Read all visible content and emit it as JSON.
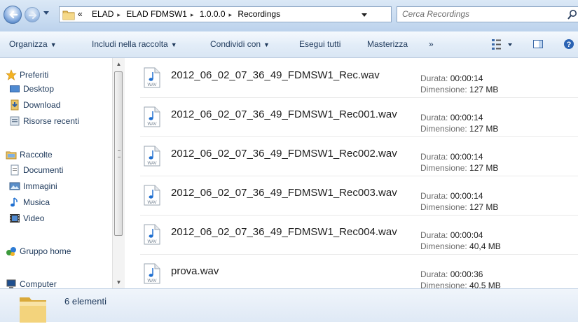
{
  "address": {
    "crumbs": [
      "«",
      "ELAD",
      "ELAD FDMSW1",
      "1.0.0.0",
      "Recordings"
    ],
    "search_placeholder": "Cerca Recordings"
  },
  "toolbar": {
    "organize": "Organizza",
    "include": "Includi nella raccolta",
    "share": "Condividi con",
    "play_all": "Esegui tutti",
    "burn": "Masterizza",
    "more": "»"
  },
  "nav": {
    "favorites": "Preferiti",
    "desktop": "Desktop",
    "download": "Download",
    "recent": "Risorse recenti",
    "libraries": "Raccolte",
    "documents": "Documenti",
    "pictures": "Immagini",
    "music": "Musica",
    "video": "Video",
    "homegroup": "Gruppo home",
    "computer": "Computer"
  },
  "files": [
    {
      "name": "2012_06_02_07_36_49_FDMSW1_Rec.wav",
      "duration_label": "Durata:",
      "duration": "00:00:14",
      "size_label": "Dimensione:",
      "size": "127 MB"
    },
    {
      "name": "2012_06_02_07_36_49_FDMSW1_Rec001.wav",
      "duration_label": "Durata:",
      "duration": "00:00:14",
      "size_label": "Dimensione:",
      "size": "127 MB"
    },
    {
      "name": "2012_06_02_07_36_49_FDMSW1_Rec002.wav",
      "duration_label": "Durata:",
      "duration": "00:00:14",
      "size_label": "Dimensione:",
      "size": "127 MB"
    },
    {
      "name": "2012_06_02_07_36_49_FDMSW1_Rec003.wav",
      "duration_label": "Durata:",
      "duration": "00:00:14",
      "size_label": "Dimensione:",
      "size": "127 MB"
    },
    {
      "name": "2012_06_02_07_36_49_FDMSW1_Rec004.wav",
      "duration_label": "Durata:",
      "duration": "00:00:04",
      "size_label": "Dimensione:",
      "size": "40,4 MB"
    },
    {
      "name": "prova.wav",
      "duration_label": "Durata:",
      "duration": "00:00:36",
      "size_label": "Dimensione:",
      "size": "40,5 MB"
    }
  ],
  "file_icon_label": "WAV",
  "status": {
    "count": "6 elementi"
  },
  "icons": {
    "back": "back-arrow-icon",
    "forward": "forward-arrow-icon",
    "refresh": "refresh-icon",
    "search": "search-icon",
    "view": "view-options-icon",
    "preview_pane": "preview-pane-icon",
    "help": "help-icon",
    "file": "wav-file-icon"
  },
  "colors": {
    "accent": "#1e395b",
    "toolbar_bg": "#e3edf8",
    "meta_gray": "#6d6d6d"
  }
}
